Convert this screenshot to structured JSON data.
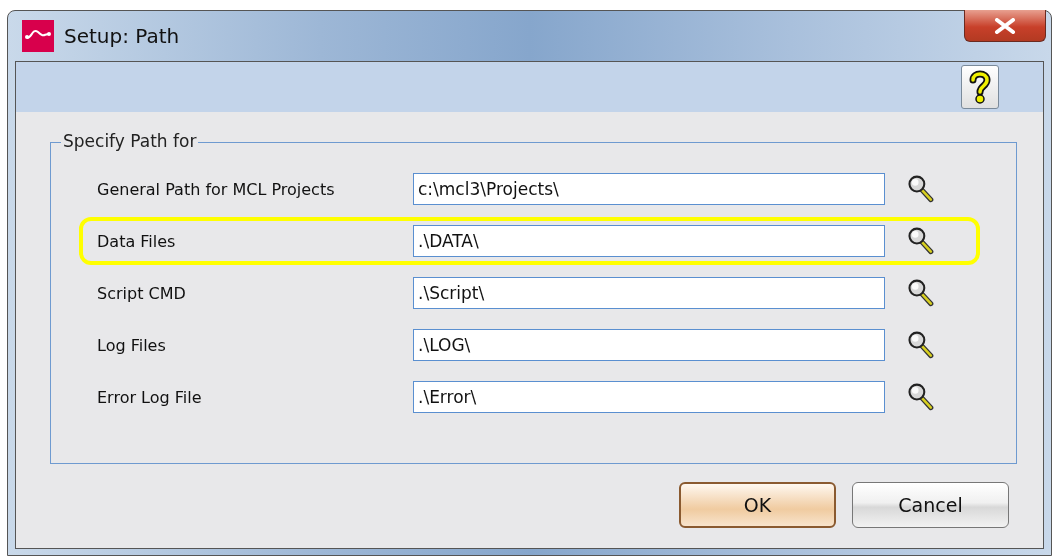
{
  "window": {
    "title": "Setup: Path"
  },
  "group": {
    "title": "Specify Path for"
  },
  "rows": [
    {
      "label": "General Path for MCL Projects",
      "value": "c:\\mcl3\\Projects\\",
      "highlighted": false
    },
    {
      "label": "Data Files",
      "value": ".\\DATA\\",
      "highlighted": true
    },
    {
      "label": "Script CMD",
      "value": ".\\Script\\",
      "highlighted": false
    },
    {
      "label": "Log Files",
      "value": ".\\LOG\\",
      "highlighted": false
    },
    {
      "label": "Error Log File",
      "value": ".\\Error\\",
      "highlighted": false
    }
  ],
  "buttons": [
    {
      "label": "OK",
      "default": true
    },
    {
      "label": "Cancel",
      "default": false
    }
  ]
}
